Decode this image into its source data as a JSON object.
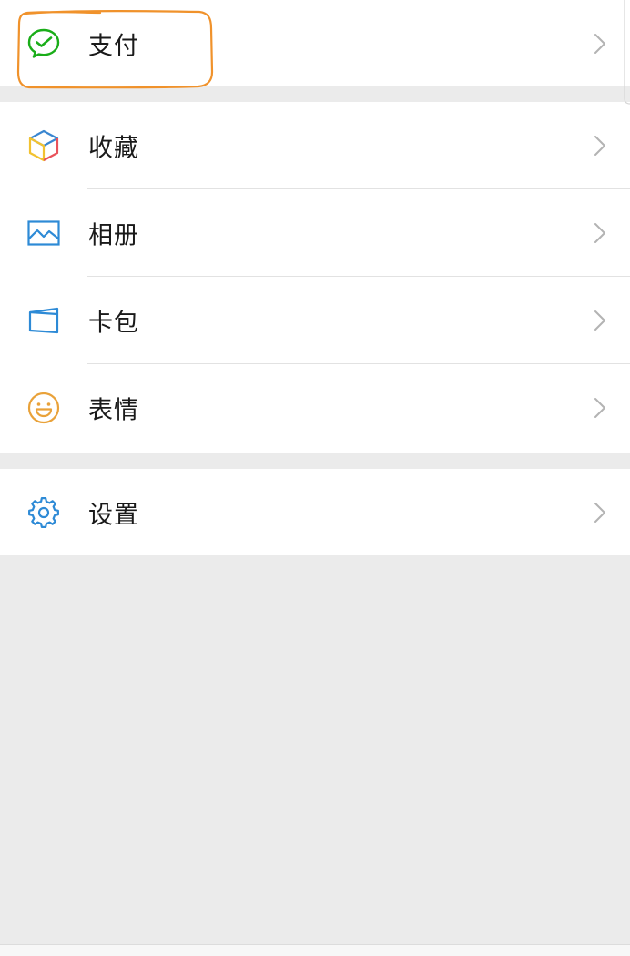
{
  "menu": {
    "pay": {
      "label": "支付",
      "icon": "wechat-pay-icon",
      "color": "#1aad19"
    },
    "favorites": {
      "label": "收藏",
      "icon": "cube-icon"
    },
    "album": {
      "label": "相册",
      "icon": "image-icon",
      "color": "#2d8ad6"
    },
    "cards": {
      "label": "卡包",
      "icon": "card-wallet-icon",
      "color": "#2d8ad6"
    },
    "stickers": {
      "label": "表情",
      "icon": "smiley-icon",
      "color": "#e9a23a"
    },
    "settings": {
      "label": "设置",
      "icon": "gear-icon",
      "color": "#2d8ad6"
    }
  },
  "annotation": {
    "type": "hand-drawn-highlight",
    "color": "#f0922b",
    "target": "支付"
  },
  "colors": {
    "background": "#ebebeb",
    "row": "#ffffff",
    "divider": "#e2e2e2",
    "chevron": "#b3b3b3"
  }
}
